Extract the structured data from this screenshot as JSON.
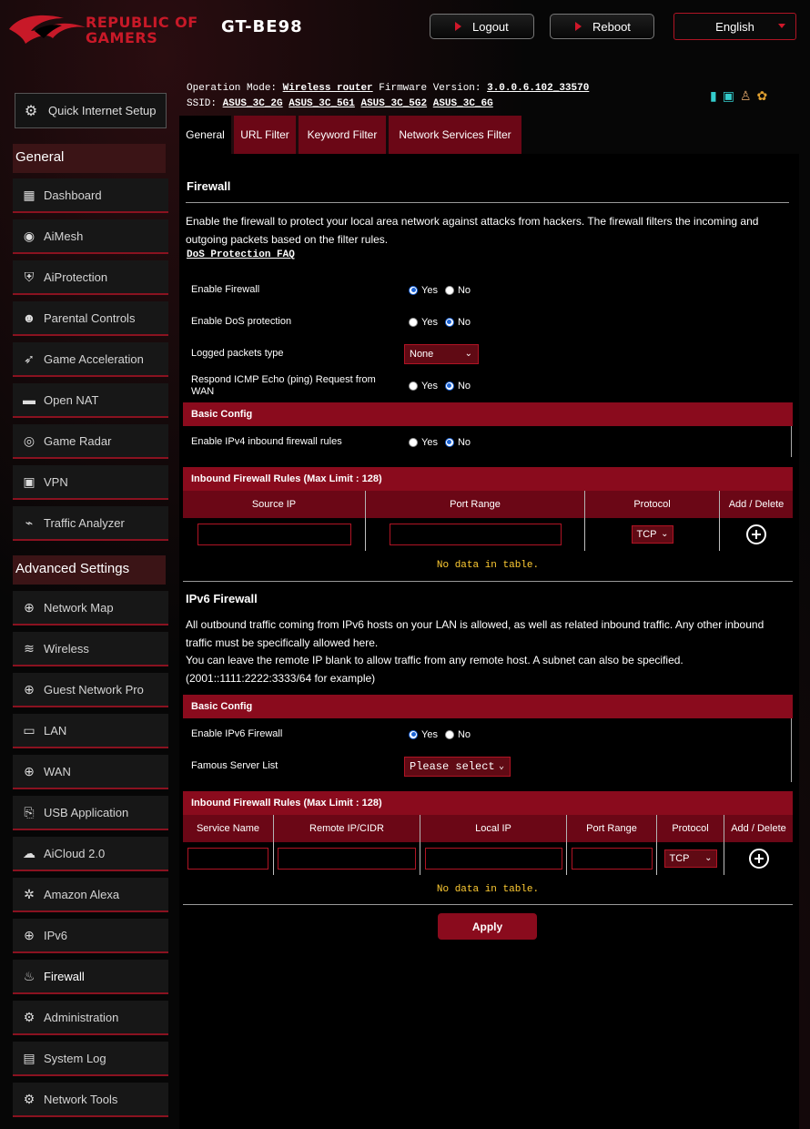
{
  "header": {
    "brand_line1": "REPUBLIC OF",
    "brand_line2": "GAMERS",
    "model": "GT-BE98",
    "logout": "Logout",
    "reboot": "Reboot",
    "language": "English"
  },
  "info": {
    "op_mode_label": "Operation Mode:",
    "op_mode_value": "Wireless router",
    "fw_label": "Firmware Version:",
    "fw_value": "3.0.0.6.102_33570",
    "ssid_label": "SSID:",
    "ssids": [
      "ASUS_3C_2G",
      "ASUS_3C_5G1",
      "ASUS_3C_5G2",
      "ASUS_3C_6G"
    ]
  },
  "sidebar": {
    "quick_setup": "Quick Internet Setup",
    "general_header": "General",
    "general_items": [
      "Dashboard",
      "AiMesh",
      "AiProtection",
      "Parental Controls",
      "Game Acceleration",
      "Open NAT",
      "Game Radar",
      "VPN",
      "Traffic Analyzer"
    ],
    "advanced_header": "Advanced Settings",
    "advanced_items": [
      "Network Map",
      "Wireless",
      "Guest Network Pro",
      "LAN",
      "WAN",
      "USB Application",
      "AiCloud 2.0",
      "Amazon Alexa",
      "IPv6",
      "Firewall",
      "Administration",
      "System Log",
      "Network Tools"
    ]
  },
  "tabs": [
    "General",
    "URL Filter",
    "Keyword Filter",
    "Network Services Filter"
  ],
  "firewall": {
    "title": "Firewall",
    "description": "Enable the firewall to protect your local area network against attacks from hackers. The firewall filters the incoming and outgoing packets based on the filter rules.",
    "faq_link": "DoS Protection FAQ",
    "enable_firewall": "Enable Firewall",
    "enable_dos": "Enable DoS protection",
    "logged_packets": "Logged packets type",
    "logged_value": "None",
    "icmp": "Respond ICMP Echo (ping) Request from WAN",
    "yes": "Yes",
    "no": "No",
    "basic_config": "Basic Config",
    "ipv4_inbound": "Enable IPv4 inbound firewall rules",
    "rules_title": "Inbound Firewall Rules (Max Limit : 128)",
    "cols": [
      "Source IP",
      "Port Range",
      "Protocol",
      "Add / Delete"
    ],
    "protocol_value": "TCP",
    "no_data": "No data in table."
  },
  "ipv6": {
    "title": "IPv6 Firewall",
    "desc1": "All outbound traffic coming from IPv6 hosts on your LAN is allowed, as well as related inbound traffic. Any other inbound traffic must be specifically allowed here.",
    "desc2": "You can leave the remote IP blank to allow traffic from any remote host. A subnet can also be specified. (2001::1111:2222:3333/64 for example)",
    "basic_config": "Basic Config",
    "enable_ipv6_fw": "Enable IPv6 Firewall",
    "famous_list": "Famous Server List",
    "famous_value": "Please select",
    "rules_title": "Inbound Firewall Rules (Max Limit : 128)",
    "cols": [
      "Service Name",
      "Remote IP/CIDR",
      "Local IP",
      "Port Range",
      "Protocol",
      "Add / Delete"
    ],
    "protocol_value": "TCP",
    "no_data": "No data in table."
  },
  "apply": "Apply"
}
